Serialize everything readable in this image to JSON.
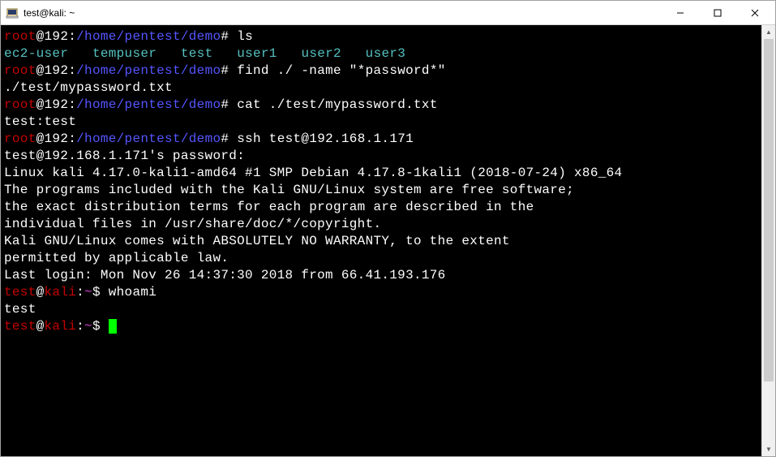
{
  "window": {
    "title": "test@kali: ~",
    "min": "—",
    "max": "☐",
    "close": "✕"
  },
  "lines": [
    {
      "segs": [
        {
          "cls": "red",
          "k": "p1.user"
        },
        {
          "cls": "",
          "k": "p1.at"
        },
        {
          "cls": "",
          "k": "p1.host"
        },
        {
          "cls": "",
          "k": "p1.colon"
        },
        {
          "cls": "blue",
          "k": "p1.path"
        },
        {
          "cls": "",
          "k": "p1.hash"
        },
        {
          "cls": "",
          "k": "p1.cmd"
        }
      ]
    },
    {
      "segs": [
        {
          "cls": "cyan",
          "k": "ls.u1"
        },
        {
          "cls": "",
          "k": "sp3"
        },
        {
          "cls": "cyan",
          "k": "ls.u2"
        },
        {
          "cls": "",
          "k": "sp3"
        },
        {
          "cls": "cyan",
          "k": "ls.u3"
        },
        {
          "cls": "",
          "k": "sp3"
        },
        {
          "cls": "cyan",
          "k": "ls.u4"
        },
        {
          "cls": "",
          "k": "sp3"
        },
        {
          "cls": "cyan",
          "k": "ls.u5"
        },
        {
          "cls": "",
          "k": "sp3"
        },
        {
          "cls": "cyan",
          "k": "ls.u6"
        }
      ]
    },
    {
      "segs": [
        {
          "cls": "red",
          "k": "p1.user"
        },
        {
          "cls": "",
          "k": "p1.at"
        },
        {
          "cls": "",
          "k": "p1.host"
        },
        {
          "cls": "",
          "k": "p1.colon"
        },
        {
          "cls": "blue",
          "k": "p1.path"
        },
        {
          "cls": "",
          "k": "p1.hash"
        },
        {
          "cls": "",
          "k": "cmd.find"
        }
      ]
    },
    {
      "segs": [
        {
          "cls": "",
          "k": "out.findpath"
        }
      ]
    },
    {
      "segs": [
        {
          "cls": "red",
          "k": "p1.user"
        },
        {
          "cls": "",
          "k": "p1.at"
        },
        {
          "cls": "",
          "k": "p1.host"
        },
        {
          "cls": "",
          "k": "p1.colon"
        },
        {
          "cls": "blue",
          "k": "p1.path"
        },
        {
          "cls": "",
          "k": "p1.hash"
        },
        {
          "cls": "",
          "k": "cmd.cat"
        }
      ]
    },
    {
      "segs": [
        {
          "cls": "",
          "k": "out.creds"
        }
      ]
    },
    {
      "segs": [
        {
          "cls": "red",
          "k": "p1.user"
        },
        {
          "cls": "",
          "k": "p1.at"
        },
        {
          "cls": "",
          "k": "p1.host"
        },
        {
          "cls": "",
          "k": "p1.colon"
        },
        {
          "cls": "blue",
          "k": "p1.path"
        },
        {
          "cls": "",
          "k": "p1.hash"
        },
        {
          "cls": "",
          "k": "cmd.ssh"
        }
      ]
    },
    {
      "segs": [
        {
          "cls": "",
          "k": "out.sshpw"
        }
      ]
    },
    {
      "segs": [
        {
          "cls": "",
          "k": "out.kernel"
        }
      ]
    },
    {
      "segs": [
        {
          "cls": "",
          "k": "out.blank"
        }
      ]
    },
    {
      "segs": [
        {
          "cls": "",
          "k": "out.motd1"
        }
      ]
    },
    {
      "segs": [
        {
          "cls": "",
          "k": "out.blank"
        }
      ]
    },
    {
      "segs": [
        {
          "cls": "",
          "k": "out.motd2"
        }
      ]
    },
    {
      "segs": [
        {
          "cls": "",
          "k": "out.lastlogin"
        }
      ]
    },
    {
      "segs": [
        {
          "cls": "red",
          "k": "p2.user"
        },
        {
          "cls": "",
          "k": "p2.at"
        },
        {
          "cls": "red",
          "k": "p2.host"
        },
        {
          "cls": "",
          "k": "p2.colon"
        },
        {
          "cls": "mag",
          "k": "p2.path"
        },
        {
          "cls": "",
          "k": "p2.dollar"
        },
        {
          "cls": "",
          "k": "cmd.whoami"
        }
      ]
    },
    {
      "segs": [
        {
          "cls": "",
          "k": "out.whoami"
        }
      ]
    },
    {
      "segs": [
        {
          "cls": "red",
          "k": "p2.user"
        },
        {
          "cls": "",
          "k": "p2.at"
        },
        {
          "cls": "red",
          "k": "p2.host"
        },
        {
          "cls": "",
          "k": "p2.colon"
        },
        {
          "cls": "mag",
          "k": "p2.path"
        },
        {
          "cls": "",
          "k": "p2.dollar"
        },
        {
          "cls": "cursor",
          "k": "out.blank"
        }
      ]
    }
  ],
  "p1": {
    "user": "root",
    "at": "@",
    "host": "192",
    "colon": ":",
    "path": "/home/pentest/demo",
    "hash": "# ",
    "cmd": "ls"
  },
  "p2": {
    "user": "test",
    "at": "@",
    "host": "kali",
    "colon": ":",
    "path": "~",
    "dollar": "$ "
  },
  "ls": {
    "u1": "ec2-user",
    "u2": "tempuser",
    "u3": "test",
    "u4": "user1",
    "u5": "user2",
    "u6": "user3"
  },
  "sp3": "   ",
  "cmd": {
    "find": "find ./ -name \"*password*\"",
    "cat": "cat ./test/mypassword.txt",
    "ssh": "ssh test@192.168.1.171",
    "whoami": "whoami"
  },
  "out": {
    "findpath": "./test/mypassword.txt",
    "creds": "test:test",
    "sshpw": "test@192.168.1.171's password:",
    "kernel": "Linux kali 4.17.0-kali1-amd64 #1 SMP Debian 4.17.8-1kali1 (2018-07-24) x86_64",
    "blank": "",
    "motd1": "The programs included with the Kali GNU/Linux system are free software;\nthe exact distribution terms for each program are described in the\nindividual files in /usr/share/doc/*/copyright.",
    "motd2": "Kali GNU/Linux comes with ABSOLUTELY NO WARRANTY, to the extent\npermitted by applicable law.",
    "lastlogin": "Last login: Mon Nov 26 14:37:30 2018 from 66.41.193.176",
    "whoami": "test"
  },
  "scroll": {
    "up": "▲",
    "down": "▼"
  }
}
